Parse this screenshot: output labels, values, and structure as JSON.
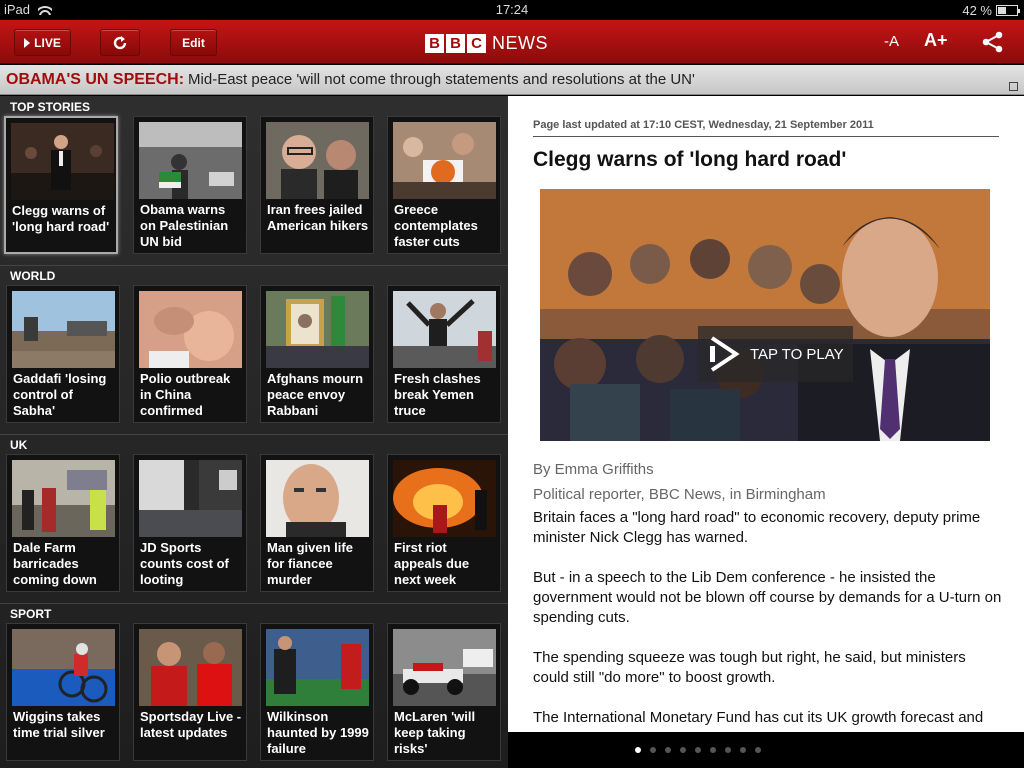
{
  "status": {
    "device": "iPad",
    "time": "17:24",
    "battery": "42 %"
  },
  "toolbar": {
    "live_label": "LIVE",
    "edit_label": "Edit",
    "logo_letters": [
      "B",
      "B",
      "C"
    ],
    "logo_news": "NEWS",
    "font_down": "-A",
    "font_up": "A+",
    "brand_color": "#a40c0c"
  },
  "ticker": {
    "headline": "OBAMA'S UN SPEECH:",
    "text": "Mid-East peace 'will not come through statements and resolutions at the UN'"
  },
  "sections": [
    {
      "label": "TOP STORIES",
      "tiles": [
        {
          "caption": "Clegg warns of 'long hard road'",
          "selected": true
        },
        {
          "caption": "Obama warns on Palestinian UN bid"
        },
        {
          "caption": "Iran frees jailed American hikers"
        },
        {
          "caption": "Greece contemplates faster cuts"
        }
      ]
    },
    {
      "label": "WORLD",
      "tiles": [
        {
          "caption": "Gaddafi 'losing control of Sabha'"
        },
        {
          "caption": "Polio outbreak in China confirmed"
        },
        {
          "caption": "Afghans mourn peace envoy Rabbani"
        },
        {
          "caption": "Fresh clashes break Yemen truce"
        }
      ]
    },
    {
      "label": "UK",
      "tiles": [
        {
          "caption": "Dale Farm barricades coming down"
        },
        {
          "caption": "JD Sports counts cost of looting"
        },
        {
          "caption": "Man given life for fiancee murder"
        },
        {
          "caption": "First riot appeals due next week"
        }
      ]
    },
    {
      "label": "SPORT",
      "tiles": [
        {
          "caption": "Wiggins takes time trial silver"
        },
        {
          "caption": "Sportsday Live - latest updates"
        },
        {
          "caption": "Wilkinson haunted by 1999 failure"
        },
        {
          "caption": "McLaren 'will keep taking risks'"
        }
      ]
    }
  ],
  "article": {
    "updated": "Page last updated at 17:10 CEST, Wednesday, 21 September 2011",
    "headline": "Clegg warns of 'long hard road'",
    "video_label": "TAP TO PLAY",
    "byline": "By Emma Griffiths",
    "role": "Political reporter, BBC News, in Birmingham",
    "paragraphs": [
      "Britain faces a \"long hard road\" to economic recovery, deputy prime minister Nick Clegg has warned.",
      "But - in a speech to the Lib Dem conference - he insisted the government would not be blown off course by demands for a U-turn on spending cuts.",
      "The spending squeeze was tough but right, he said, but ministers could still \"do more\" to boost growth.",
      "The International Monetary Fund has cut its UK growth forecast and"
    ]
  },
  "pagination": {
    "total": 9,
    "current": 1
  }
}
